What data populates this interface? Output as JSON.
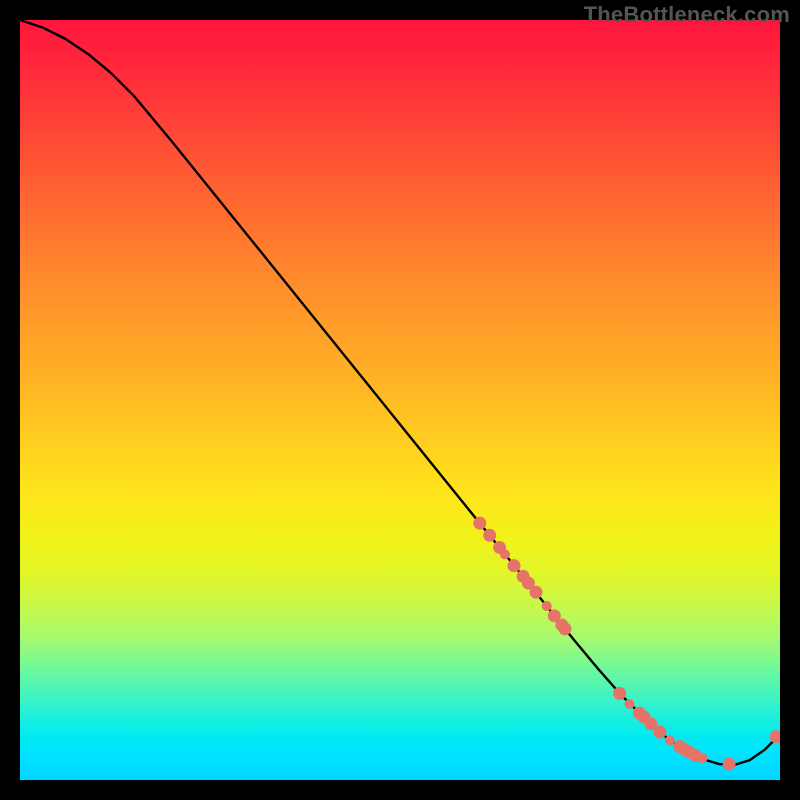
{
  "attribution": "TheBottleneck.com",
  "colors": {
    "background": "#000000",
    "curve": "#000000",
    "marker": "#e57368",
    "attribution_text": "#555555"
  },
  "chart_data": {
    "type": "line",
    "title": "",
    "xlabel": "",
    "ylabel": "",
    "xlim": [
      0,
      100
    ],
    "ylim": [
      0,
      100
    ],
    "series": [
      {
        "name": "bottleneck-curve",
        "x": [
          0,
          3,
          6,
          9,
          12,
          15,
          20,
          30,
          40,
          50,
          60,
          66,
          70,
          73,
          76,
          79,
          82,
          84,
          86,
          88,
          90,
          92,
          94,
          96,
          98,
          100
        ],
        "values": [
          100,
          99,
          97.5,
          95.5,
          93,
          90,
          84,
          71.6,
          59.2,
          46.8,
          34.4,
          27,
          22,
          18.3,
          14.7,
          11.3,
          8.3,
          6.4,
          4.9,
          3.6,
          2.7,
          2.1,
          2.0,
          2.6,
          4.0,
          6.0
        ]
      }
    ],
    "markers": [
      {
        "x": 60.5,
        "y": 33.8
      },
      {
        "x": 61.8,
        "y": 32.2
      },
      {
        "x": 63.1,
        "y": 30.6
      },
      {
        "x": 63.8,
        "y": 29.7
      },
      {
        "x": 65.0,
        "y": 28.2
      },
      {
        "x": 66.2,
        "y": 26.8
      },
      {
        "x": 66.9,
        "y": 25.9
      },
      {
        "x": 67.9,
        "y": 24.7
      },
      {
        "x": 69.3,
        "y": 22.9
      },
      {
        "x": 70.3,
        "y": 21.6
      },
      {
        "x": 71.3,
        "y": 20.4
      },
      {
        "x": 71.7,
        "y": 19.9
      },
      {
        "x": 78.9,
        "y": 11.4
      },
      {
        "x": 80.2,
        "y": 10.0
      },
      {
        "x": 81.5,
        "y": 8.8
      },
      {
        "x": 82.1,
        "y": 8.3
      },
      {
        "x": 83.0,
        "y": 7.4
      },
      {
        "x": 84.2,
        "y": 6.3
      },
      {
        "x": 85.5,
        "y": 5.2
      },
      {
        "x": 86.8,
        "y": 4.4
      },
      {
        "x": 87.3,
        "y": 4.1
      },
      {
        "x": 88.0,
        "y": 3.7
      },
      {
        "x": 88.9,
        "y": 3.2
      },
      {
        "x": 89.8,
        "y": 2.9
      },
      {
        "x": 93.3,
        "y": 2.1
      },
      {
        "x": 99.5,
        "y": 5.7
      }
    ],
    "marker_radii": {
      "default": 6.5,
      "small": 5
    }
  }
}
